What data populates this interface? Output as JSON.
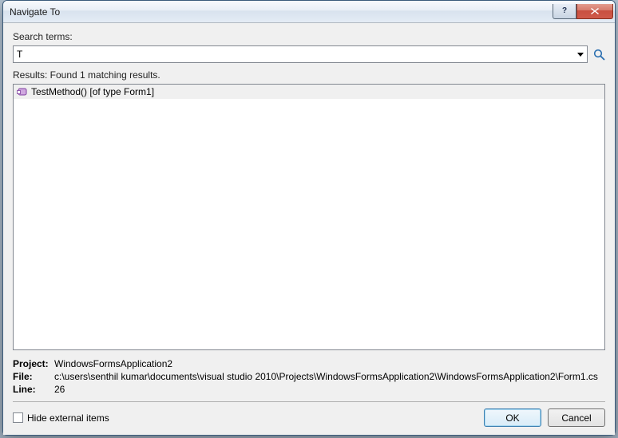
{
  "window": {
    "title": "Navigate To"
  },
  "labels": {
    "search": "Search terms:",
    "results": "Results: Found 1 matching results.",
    "project": "Project:",
    "file": "File:",
    "line": "Line:"
  },
  "search": {
    "value": "T"
  },
  "results": [
    {
      "label": "TestMethod() [of type Form1]"
    }
  ],
  "details": {
    "project": "WindowsFormsApplication2",
    "file": "c:\\users\\senthil kumar\\documents\\visual studio 2010\\Projects\\WindowsFormsApplication2\\WindowsFormsApplication2\\Form1.cs",
    "line": "26"
  },
  "checkbox": {
    "hide_external": "Hide external items"
  },
  "buttons": {
    "ok": "OK",
    "cancel": "Cancel"
  }
}
